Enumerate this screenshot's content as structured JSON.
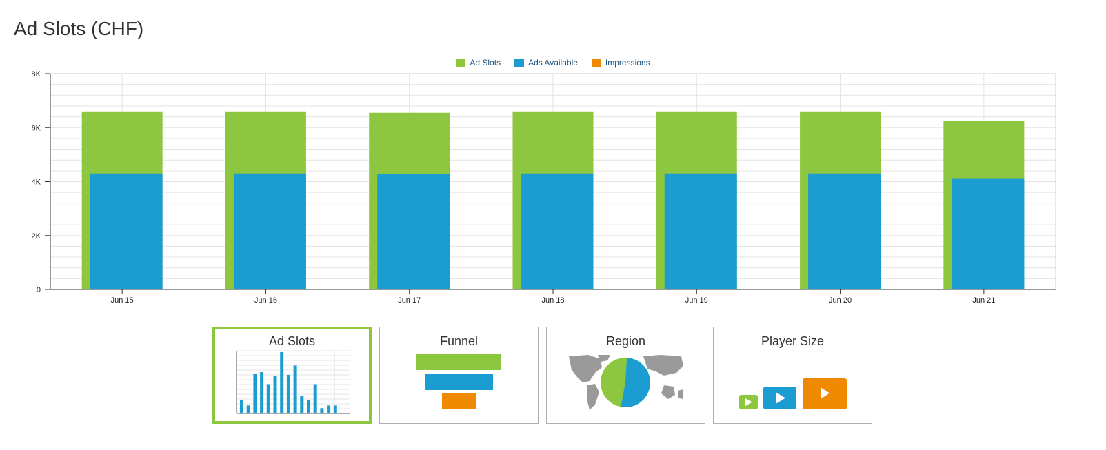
{
  "page": {
    "title": "Ad Slots (CHF)"
  },
  "colors": {
    "ad_slots": "#8dc63f",
    "ads_available": "#1b9dd2",
    "impressions": "#ef8a00"
  },
  "chart_data": {
    "type": "bar",
    "categories": [
      "Jun 15",
      "Jun 16",
      "Jun 17",
      "Jun 18",
      "Jun 19",
      "Jun 20",
      "Jun 21"
    ],
    "series": [
      {
        "name": "Ad Slots",
        "values": [
          6600,
          6600,
          6550,
          6600,
          6600,
          6600,
          6250
        ]
      },
      {
        "name": "Ads Available",
        "values": [
          4300,
          4300,
          4280,
          4300,
          4300,
          4300,
          4100
        ]
      },
      {
        "name": "Impressions",
        "values": [
          0,
          0,
          0,
          0,
          0,
          0,
          0
        ]
      }
    ],
    "ylim": [
      0,
      8000
    ],
    "yticks": [
      0,
      2000,
      4000,
      6000,
      8000
    ],
    "ytick_labels": [
      "0",
      "2K",
      "4K",
      "6K",
      "8K"
    ],
    "grid": true,
    "legend": "top-center"
  },
  "tiles": [
    {
      "label": "Ad Slots",
      "active": true
    },
    {
      "label": "Funnel",
      "active": false
    },
    {
      "label": "Region",
      "active": false
    },
    {
      "label": "Player Size",
      "active": false
    }
  ],
  "thumb_data": {
    "ad_slots_bars": [
      5,
      3,
      15,
      15.5,
      11,
      14,
      23,
      14.5,
      18,
      6.5,
      5,
      11,
      2,
      3,
      3
    ],
    "ad_slots_bars_max": 23,
    "region_pie_green_fraction": 0.48
  }
}
